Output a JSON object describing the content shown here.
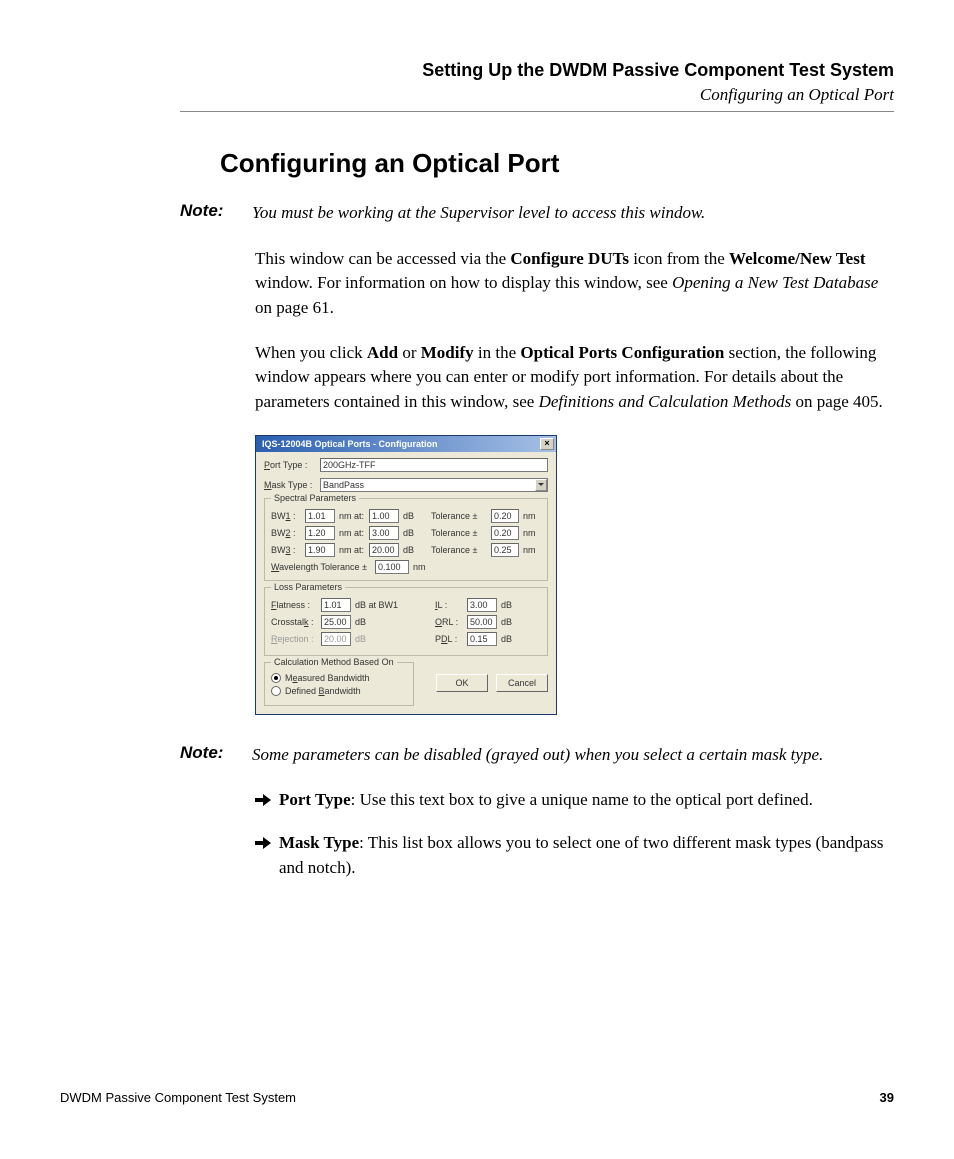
{
  "header": {
    "chapter": "Setting Up the DWDM Passive Component Test System",
    "section": "Configuring an Optical Port"
  },
  "section_title": "Configuring an Optical Port",
  "note_label": "Note:",
  "note1": "You must be working at the Supervisor level to access this window.",
  "para1": {
    "t1": "This window can be accessed via the ",
    "b1": "Configure DUTs",
    "t2": " icon from the ",
    "b2": "Welcome/New Test",
    "t3": " window. For information on how to display this window, see ",
    "i1": "Opening a New Test Database",
    "t4": " on page 61."
  },
  "para2": {
    "t1": "When you click ",
    "b1": "Add",
    "t2": " or ",
    "b2": "Modify",
    "t3": " in the ",
    "b3": "Optical Ports Configuration",
    "t4": " section, the following window appears where you can enter or modify port information. For details about the parameters contained in this window, see ",
    "i1": "Definitions and Calculation Methods",
    "t5": " on page 405."
  },
  "dialog": {
    "title": "IQS-12004B Optical Ports - Configuration",
    "port_type_label": "Port Type :",
    "port_type_value": "200GHz-TFF",
    "mask_type_label": "Mask Type :",
    "mask_type_value": "BandPass",
    "spectral_group": "Spectral Parameters",
    "bw_rows": [
      {
        "label": "BW1 :",
        "bw": "1.01",
        "u1": "nm at:",
        "at": "1.00",
        "u2": "dB",
        "tol_label": "Tolerance ±",
        "tol": "0.20",
        "tu": "nm"
      },
      {
        "label": "BW2 :",
        "bw": "1.20",
        "u1": "nm at:",
        "at": "3.00",
        "u2": "dB",
        "tol_label": "Tolerance ±",
        "tol": "0.20",
        "tu": "nm"
      },
      {
        "label": "BW3 :",
        "bw": "1.90",
        "u1": "nm at:",
        "at": "20.00",
        "u2": "dB",
        "tol_label": "Tolerance ±",
        "tol": "0.25",
        "tu": "nm"
      }
    ],
    "wavelength_tol_label": "Wavelength Tolerance ±",
    "wavelength_tol_value": "0.100",
    "wavelength_tol_unit": "nm",
    "loss_group": "Loss Parameters",
    "loss_rows": [
      {
        "ll": "Flatness :",
        "lv": "1.01",
        "lu": "dB at BW1",
        "rl": "IL :",
        "rv": "3.00",
        "ru": "dB"
      },
      {
        "ll": "Crosstalk :",
        "lv": "25.00",
        "lu": "dB",
        "rl": "ORL :",
        "rv": "50.00",
        "ru": "dB"
      },
      {
        "ll": "Rejection :",
        "lv": "20.00",
        "lu": "dB",
        "rl": "PDL :",
        "rv": "0.15",
        "ru": "dB",
        "disabled": true
      }
    ],
    "calc_group": "Calculation Method Based On",
    "radio1": "Measured Bandwidth",
    "radio2": "Defined Bandwidth",
    "ok": "OK",
    "cancel": "Cancel"
  },
  "note2": "Some parameters can be disabled (grayed out) when you select a certain mask type.",
  "bullets": [
    {
      "b": "Port Type",
      "t": ": Use this text box to give a unique name to the optical port defined."
    },
    {
      "b": "Mask Type",
      "t": ": This list box allows you to select one of two different mask types (bandpass and notch)."
    }
  ],
  "footer": {
    "left": "DWDM Passive Component Test System",
    "page": "39"
  }
}
